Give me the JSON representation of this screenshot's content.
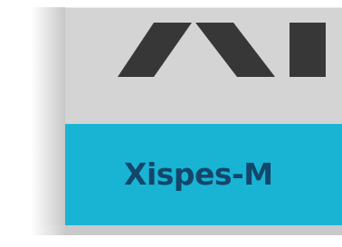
{
  "banner": {
    "title": "Xispes-M"
  },
  "colors": {
    "logo_background": "#d4d4d4",
    "logo_shapes": "#373737",
    "banner_background": "#19b4d4",
    "banner_text": "#13466a"
  },
  "icons": {
    "logo": "xispes-logo-mark"
  }
}
